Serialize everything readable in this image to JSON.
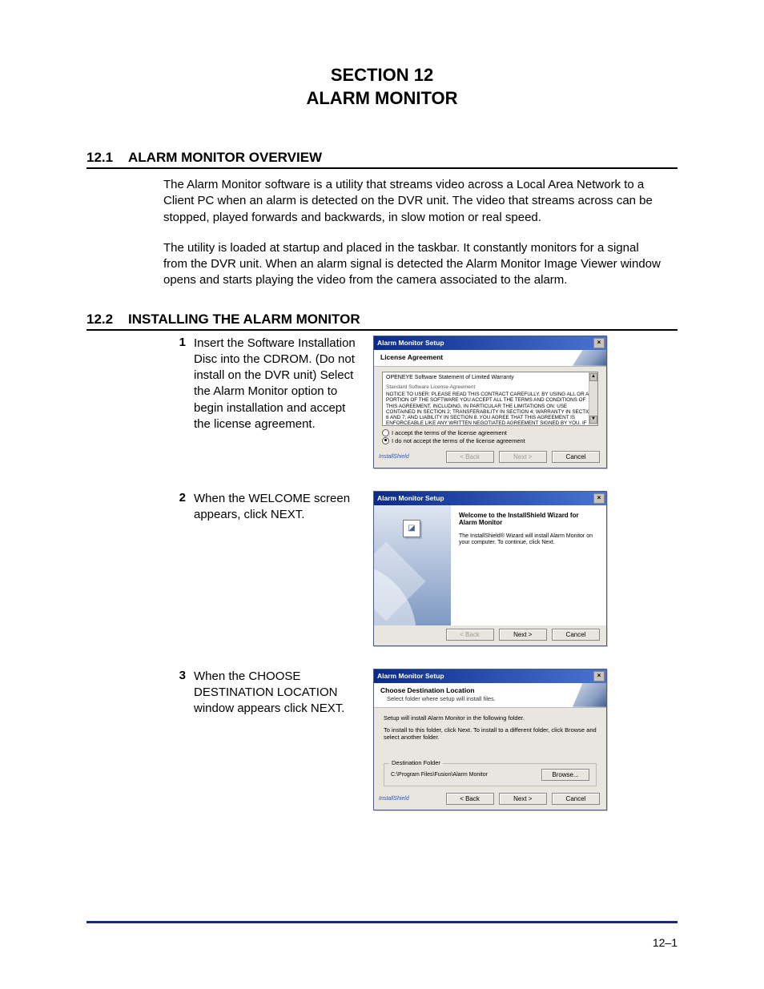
{
  "section": {
    "line1": "SECTION 12",
    "line2": "ALARM MONITOR"
  },
  "sub1": {
    "num": "12.1",
    "title": "ALARM MONITOR OVERVIEW",
    "p1": "The Alarm Monitor software is a utility that streams video across a Local Area Network to a Client PC when an alarm is detected on the DVR unit. The video that streams across can be stopped, played forwards and backwards, in slow motion or real speed.",
    "p2": "The utility is loaded at startup and placed in the taskbar. It constantly monitors for a signal from the DVR unit. When an alarm signal is detected the Alarm Monitor Image Viewer window opens and starts playing the video from the camera associated to the alarm."
  },
  "sub2": {
    "num": "12.2",
    "title": "INSTALLING THE ALARM MONITOR"
  },
  "steps": {
    "s1": {
      "num": "1",
      "text": "Insert the Software Installation Disc into the CDROM. (Do not install on the DVR unit) Select the Alarm Monitor option to begin installation and accept the license agreement."
    },
    "s2": {
      "num": "2",
      "text": "When the WELCOME screen appears, click NEXT."
    },
    "s3": {
      "num": "3",
      "text": "When the CHOOSE DESTINATION LOCATION window appears click NEXT."
    }
  },
  "dlg_license": {
    "title": "Alarm Monitor Setup",
    "sub_title": "License Agreement",
    "warranty": "OPENEYE Software Statement of Limited Warranty",
    "sla": "Standard Software License Agreement",
    "notice": "NOTICE TO USER: PLEASE READ THIS CONTRACT CAREFULLY. BY USING ALL OR ANY PORTION OF THE SOFTWARE YOU ACCEPT ALL THE TERMS AND CONDITIONS OF THIS AGREEMENT, INCLUDING, IN PARTICULAR THE LIMITATIONS ON: USE CONTAINED IN SECTION 2; TRANSFERABILITY IN SECTION 4; WARRANTY IN SECTION 6 AND 7; AND LIABILITY IN SECTION 8. YOU AGREE THAT THIS AGREEMENT IS ENFORCEABLE LIKE ANY WRITTEN NEGOTIATED AGREEMENT SIGNED BY YOU. IF YOU DO NOT AGREE, DO NOT USE THIS",
    "radio_accept": "I accept the terms of the license agreement",
    "radio_reject": "I do not accept the terms of the license agreement",
    "installshield": "InstallShield",
    "btn_back": "< Back",
    "btn_next": "Next >",
    "btn_cancel": "Cancel"
  },
  "dlg_welcome": {
    "title": "Alarm Monitor Setup",
    "w_title": "Welcome to the InstallShield Wizard for Alarm Monitor",
    "w_text": "The InstallShield® Wizard will install Alarm Monitor on your computer. To continue, click Next.",
    "btn_back": "< Back",
    "btn_next": "Next >",
    "btn_cancel": "Cancel"
  },
  "dlg_dest": {
    "title": "Alarm Monitor Setup",
    "sub_title": "Choose Destination Location",
    "sub_desc": "Select folder where setup will install files.",
    "line1": "Setup will install Alarm Monitor in the following folder.",
    "line2": "To install to this folder, click Next. To install to a different folder, click Browse and select another folder.",
    "group_legend": "Destination Folder",
    "path": "C:\\Program Files\\Fusion\\Alarm Monitor",
    "btn_browse": "Browse...",
    "installshield": "InstallShield",
    "btn_back": "< Back",
    "btn_next": "Next >",
    "btn_cancel": "Cancel"
  },
  "page_number": "12–1"
}
